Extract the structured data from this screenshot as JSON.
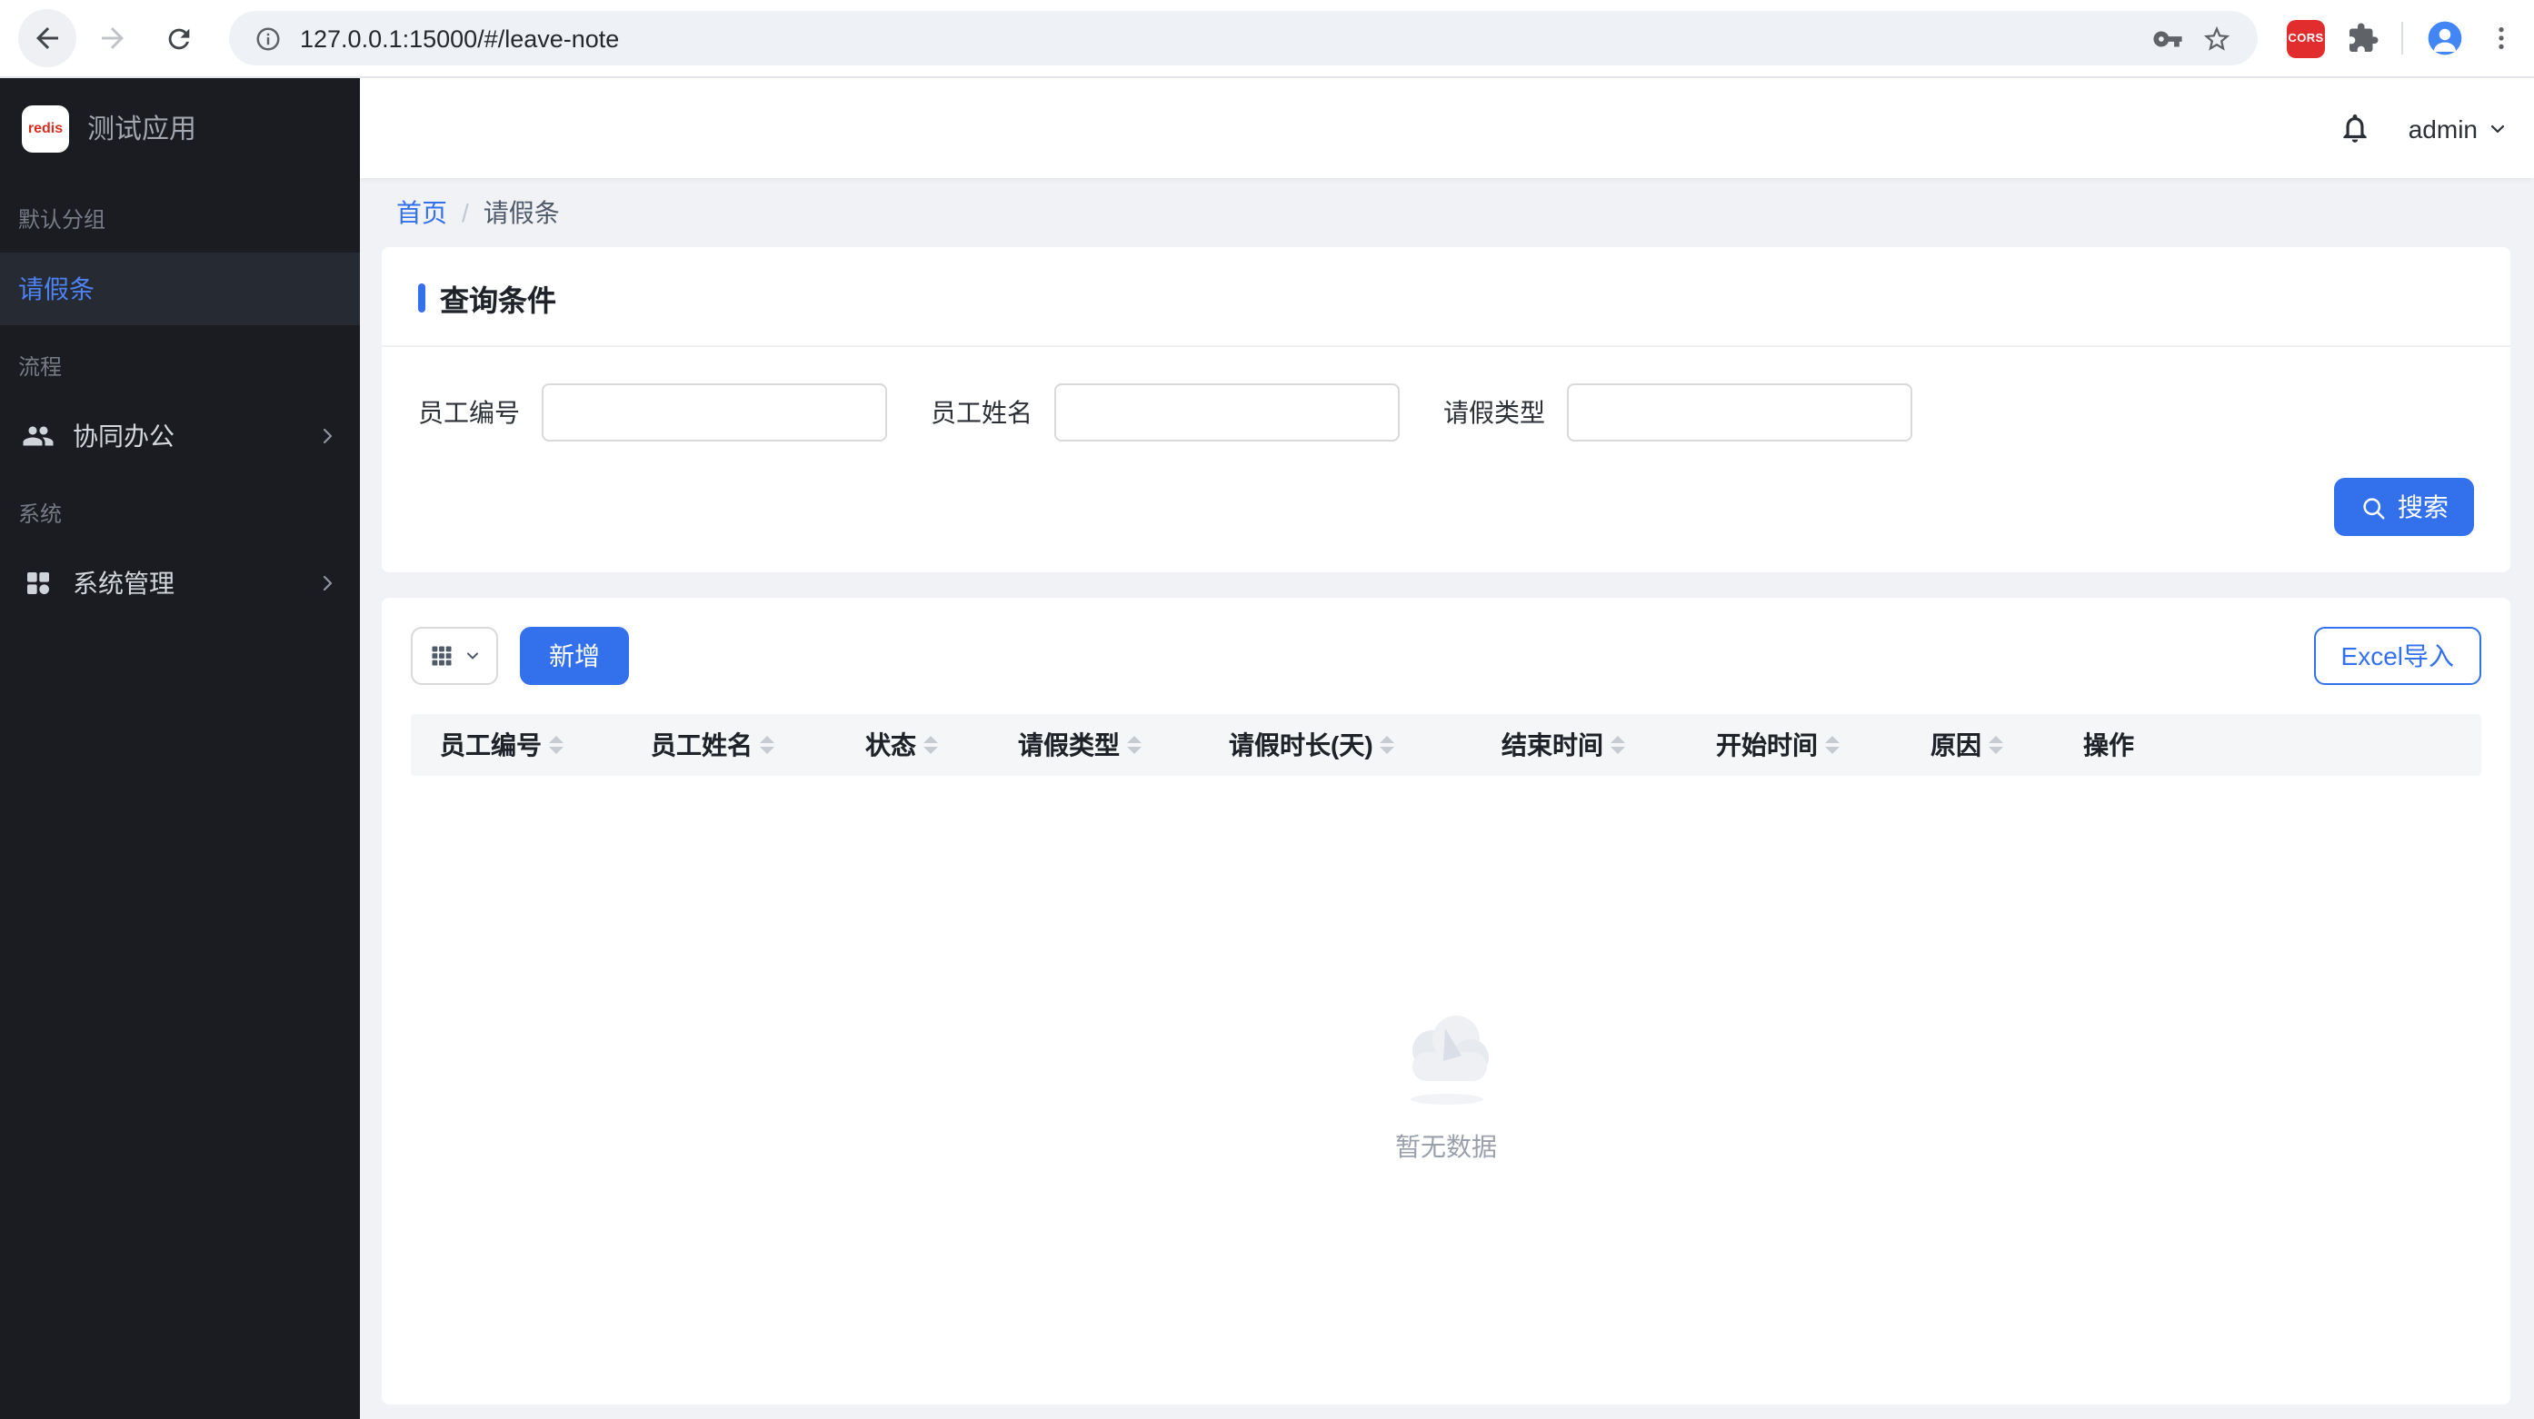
{
  "colors": {
    "accent": "#3370eb",
    "sidebar_bg": "#1a1c22",
    "sidebar_active_bg": "#262a33",
    "sidebar_active_text": "#4d82f2",
    "content_bg": "#f0f2f5",
    "cors_red": "#e12d2d"
  },
  "browser": {
    "url": "127.0.0.1:15000/#/leave-note",
    "cors_badge": "CORS"
  },
  "sidebar": {
    "logo_mark": "redis",
    "app_title": "测试应用",
    "groups": [
      {
        "label": "默认分组",
        "items": [
          {
            "label": "请假条"
          }
        ]
      },
      {
        "label": "流程",
        "items": [
          {
            "label": "协同办公"
          }
        ]
      },
      {
        "label": "系统",
        "items": [
          {
            "label": "系统管理"
          }
        ]
      }
    ]
  },
  "header": {
    "user": "admin"
  },
  "breadcrumb": {
    "home": "首页",
    "separator": "/",
    "current": "请假条"
  },
  "query": {
    "title": "查询条件",
    "fields": [
      {
        "label": "员工编号",
        "value": ""
      },
      {
        "label": "员工姓名",
        "value": ""
      },
      {
        "label": "请假类型",
        "value": ""
      }
    ],
    "search_label": "搜索"
  },
  "toolbar": {
    "add_label": "新增",
    "excel_label": "Excel导入"
  },
  "table": {
    "columns": [
      {
        "label": "员工编号",
        "sortable": true
      },
      {
        "label": "员工姓名",
        "sortable": true
      },
      {
        "label": "状态",
        "sortable": true
      },
      {
        "label": "请假类型",
        "sortable": true
      },
      {
        "label": "请假时长(天)",
        "sortable": true
      },
      {
        "label": "结束时间",
        "sortable": true
      },
      {
        "label": "开始时间",
        "sortable": true
      },
      {
        "label": "原因",
        "sortable": true
      },
      {
        "label": "操作",
        "sortable": false
      }
    ],
    "empty_text": "暂无数据"
  }
}
